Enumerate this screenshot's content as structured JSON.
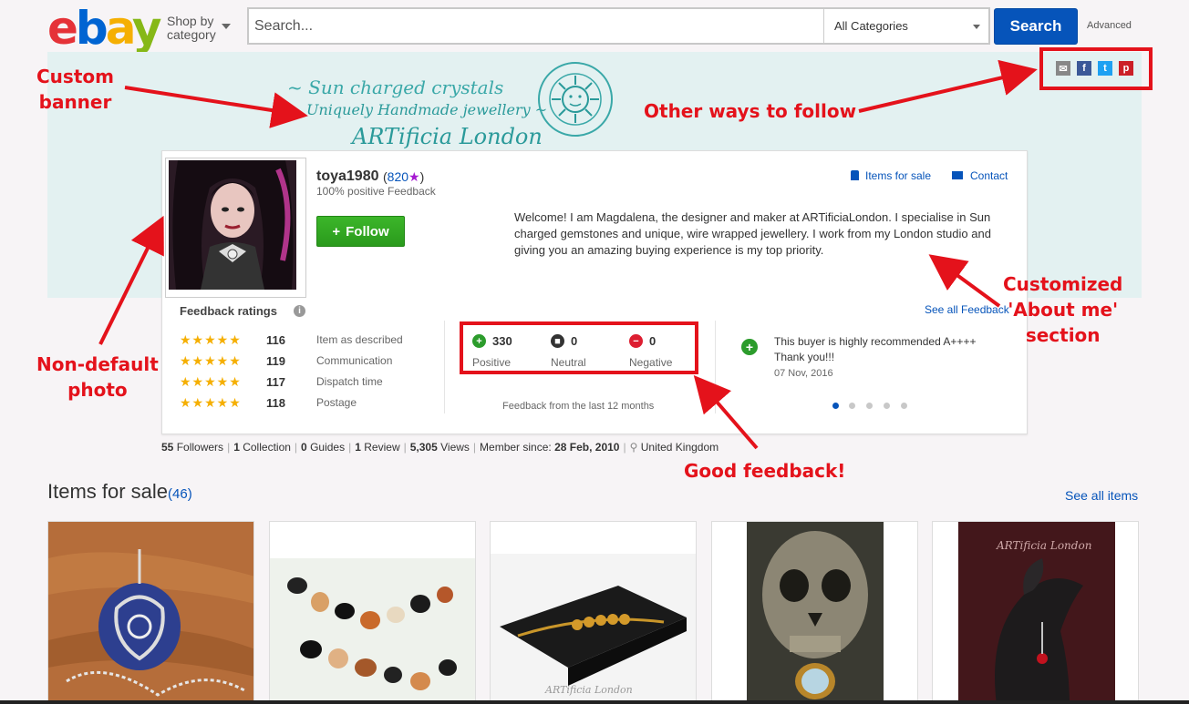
{
  "header": {
    "logo": {
      "e": "e",
      "b": "b",
      "a": "a",
      "y": "y"
    },
    "shop_by_line1": "Shop by",
    "shop_by_line2": "category",
    "search_placeholder": "Search...",
    "category": "All Categories",
    "search_button": "Search",
    "advanced": "Advanced"
  },
  "banner": {
    "line1": "~ Sun charged crystals",
    "line2": "Uniquely Handmade jewellery ~",
    "line3": "ARTificia London",
    "social_icons": [
      "mail-icon",
      "facebook-icon",
      "twitter-icon",
      "pinterest-icon"
    ]
  },
  "profile": {
    "username": "toya1980",
    "score_open": "(",
    "score": "820",
    "score_star": "★",
    "score_close": ")",
    "positive_feedback": "100% positive Feedback",
    "follow_label": "Follow",
    "items_for_sale_link": "Items for sale",
    "contact_link": "Contact",
    "about": "Welcome! I am Magdalena, the designer and maker at ARTificiaLondon. I specialise in Sun charged gemstones and unique, wire wrapped jewellery. I work from my London studio and giving you an amazing buying experience is my top priority."
  },
  "feedback": {
    "title": "Feedback ratings",
    "info_icon": "i",
    "ratings": [
      {
        "stars": "★★★★★",
        "value": "116",
        "label": "Item as described"
      },
      {
        "stars": "★★★★★",
        "value": "119",
        "label": "Communication"
      },
      {
        "stars": "★★★★★",
        "value": "117",
        "label": "Dispatch time"
      },
      {
        "stars": "★★★★★",
        "value": "118",
        "label": "Postage"
      }
    ],
    "positive": {
      "icon": "+",
      "count": "330",
      "label": "Positive"
    },
    "neutral": {
      "icon": "■",
      "count": "0",
      "label": "Neutral"
    },
    "negative": {
      "icon": "−",
      "count": "0",
      "label": "Negative"
    },
    "period": "Feedback from the last 12 months",
    "see_all": "See all Feedback",
    "comment_icon": "+",
    "comment_line1": "This buyer is highly recommended A++++",
    "comment_line2": "Thank you!!!",
    "comment_date": "07 Nov, 2016",
    "carousel_dots": 5
  },
  "stats": {
    "followers_num": "55",
    "followers_lbl": "Followers",
    "collection_num": "1",
    "collection_lbl": "Collection",
    "guides_num": "0",
    "guides_lbl": "Guides",
    "review_num": "1",
    "review_lbl": "Review",
    "views_num": "5,305",
    "views_lbl": "Views",
    "member_lbl": "Member since:",
    "member_date": "28 Feb, 2010",
    "location": "United Kingdom"
  },
  "items": {
    "title": "Items for sale",
    "count": "(46)",
    "see_all": "See all items",
    "watermark": "ARTificia London"
  },
  "annotations": {
    "custom_banner_1": "Custom",
    "custom_banner_2": "banner",
    "other_ways": "Other ways to follow",
    "customized_1": "Customized",
    "customized_2": "'About me'",
    "customized_3": "section",
    "non_default_1": "Non-default",
    "non_default_2": "photo",
    "good_feedback": "Good feedback!"
  },
  "colors": {
    "accent": "#0654ba",
    "annotation_red": "#e4121b",
    "follow_green": "#2c9c2c",
    "banner_bg": "#e3f1f1",
    "star_gold": "#f5af02"
  }
}
